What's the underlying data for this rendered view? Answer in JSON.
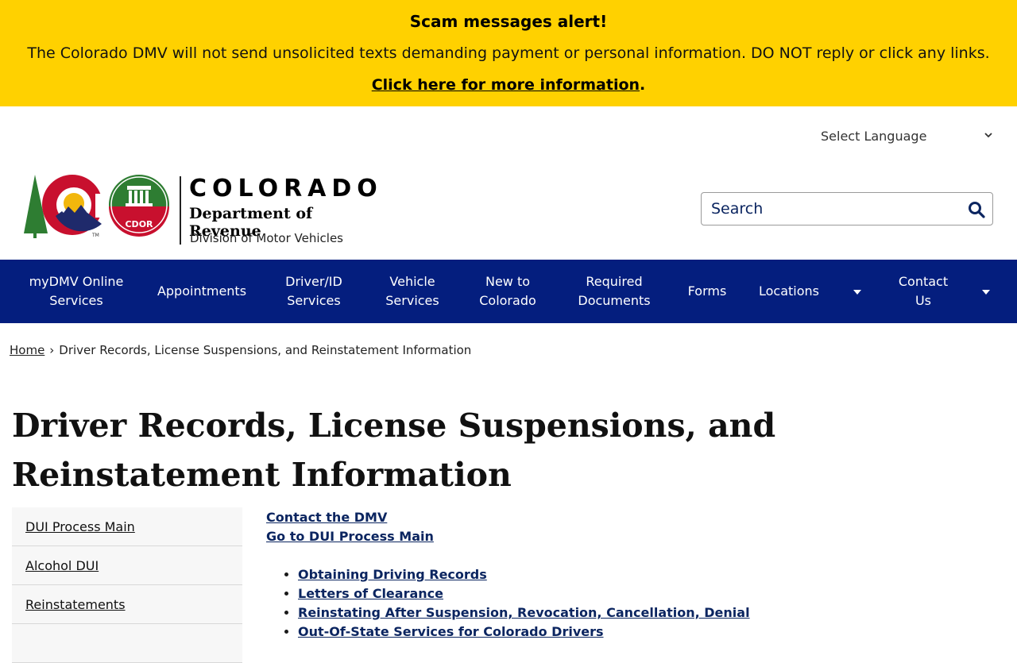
{
  "alert": {
    "title": "Scam messages alert!",
    "body": "The Colorado DMV will not send unsolicited texts demanding payment or personal information. DO NOT reply or click any links.",
    "link_label": "Click here for more information",
    "link_suffix": "."
  },
  "header": {
    "language_select": "Select Language",
    "brand_state": "COLORADO",
    "brand_department": "Department of Revenue",
    "brand_division": "Division of Motor Vehicles",
    "seal_text": "CDOR",
    "trademark": "TM",
    "search_placeholder": "Search"
  },
  "nav": {
    "items": [
      {
        "label": "myDMV Online Services"
      },
      {
        "label": "Appointments"
      },
      {
        "label": "Driver/ID Services"
      },
      {
        "label": "Vehicle Services"
      },
      {
        "label": "New to Colorado"
      },
      {
        "label": "Required Documents"
      },
      {
        "label": "Forms"
      },
      {
        "label": "Locations"
      },
      {
        "label": "Contact Us"
      }
    ]
  },
  "breadcrumb": {
    "home": "Home",
    "separator": "›",
    "current": "Driver Records, License Suspensions, and Reinstatement Information"
  },
  "page": {
    "title": "Driver Records, License Suspensions, and Reinstatement Information"
  },
  "sidebar": {
    "items": [
      {
        "label": "DUI Process Main"
      },
      {
        "label": "Alcohol DUI"
      },
      {
        "label": "Reinstatements"
      }
    ]
  },
  "content": {
    "top_links": [
      "Contact the DMV",
      "Go to DUI Process Main"
    ],
    "list": [
      "Obtaining Driving Records",
      "Letters of Clearance",
      "Reinstating After Suspension, Revocation, Cancellation, Denial",
      "Out-Of-State Services for Colorado Drivers"
    ]
  },
  "colors": {
    "alert_bg": "#ffd100",
    "nav_bg": "#041e7e",
    "link": "#0b2560",
    "co_red": "#c8102e",
    "co_blue": "#1f2a6b",
    "co_green": "#2e7d32",
    "co_gold": "#f2b70c"
  },
  "icons": {
    "search": "magnifying-glass-icon",
    "dropdown": "chevron-down-icon",
    "nav_caret": "caret-down-icon"
  }
}
